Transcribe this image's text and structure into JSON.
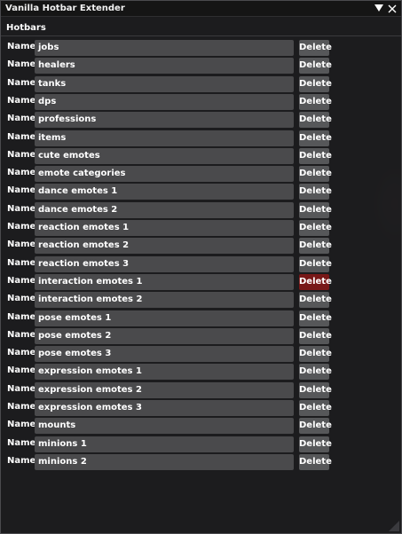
{
  "window": {
    "title": "Vanilla Hotbar Extender",
    "section_title": "Hotbars"
  },
  "icons": {
    "collapse": "triangle-down-icon",
    "close": "close-icon",
    "resize": "resize-grip-icon"
  },
  "colors": {
    "window_bg": "#1c1c1e",
    "input_bg": "#4a4a4c",
    "button_bg": "#565759",
    "button_active": "#781818"
  },
  "row_label": "Name",
  "delete_label": "Delete",
  "hotbars": [
    {
      "name": "jobs"
    },
    {
      "name": "healers"
    },
    {
      "name": "tanks"
    },
    {
      "name": "dps"
    },
    {
      "name": "professions"
    },
    {
      "name": "items"
    },
    {
      "name": "cute emotes"
    },
    {
      "name": "emote categories"
    },
    {
      "name": "dance emotes 1"
    },
    {
      "name": "dance emotes 2"
    },
    {
      "name": "reaction emotes 1"
    },
    {
      "name": "reaction emotes 2"
    },
    {
      "name": "reaction emotes 3"
    },
    {
      "name": "interaction emotes 1",
      "delete_active": true
    },
    {
      "name": "interaction emotes 2"
    },
    {
      "name": "pose emotes 1"
    },
    {
      "name": "pose emotes 2"
    },
    {
      "name": "pose emotes 3"
    },
    {
      "name": "expression emotes 1"
    },
    {
      "name": "expression emotes 2"
    },
    {
      "name": "expression emotes 3"
    },
    {
      "name": "mounts"
    },
    {
      "name": "minions 1"
    },
    {
      "name": "minions 2"
    }
  ]
}
